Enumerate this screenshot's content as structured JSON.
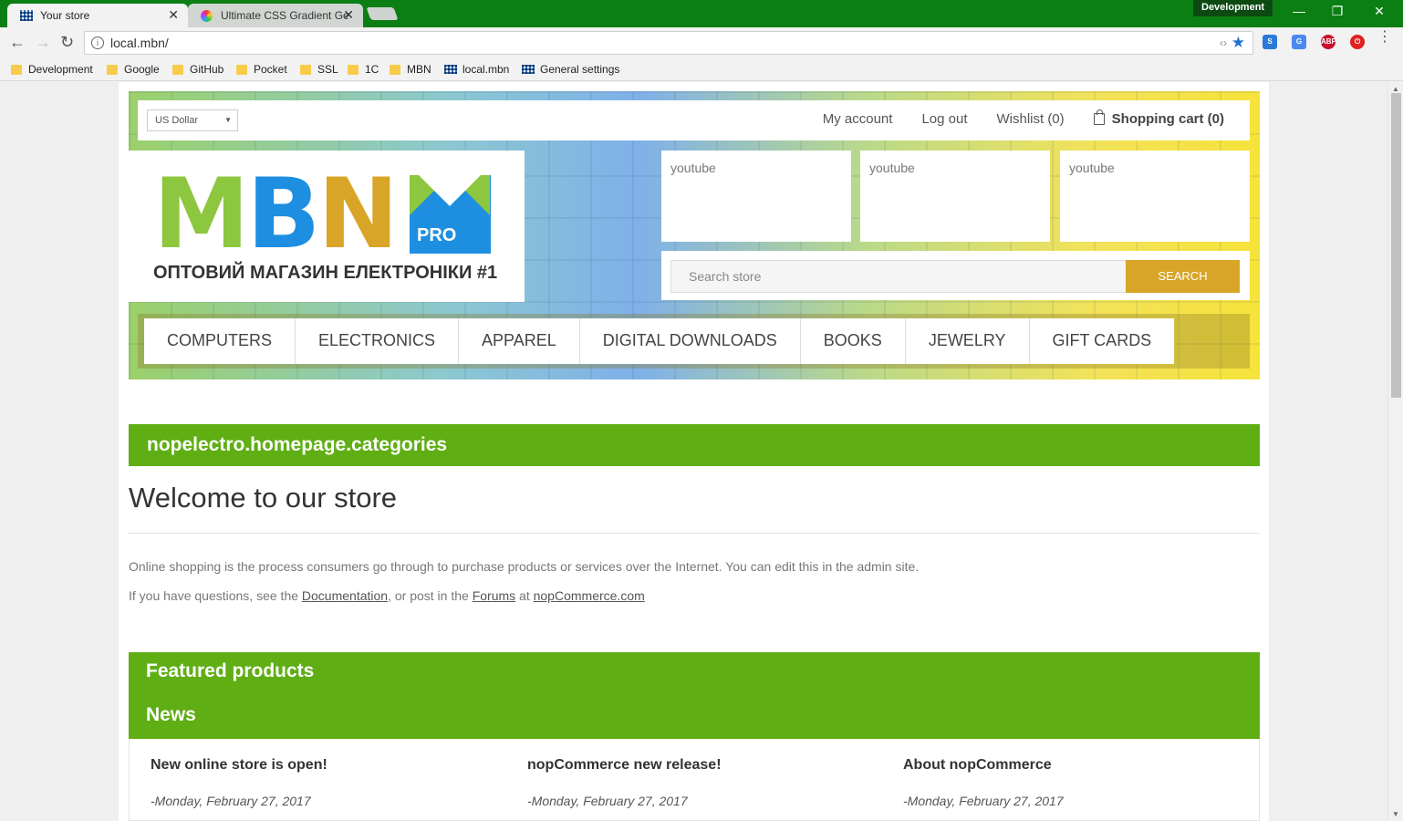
{
  "browser": {
    "tabs": [
      {
        "title": "Your store",
        "active": true
      },
      {
        "title": "Ultimate CSS Gradient Generator",
        "active": false
      }
    ],
    "profile": "Development",
    "url": "local.mbn/",
    "bookmarks": [
      {
        "label": "Development",
        "icon": "folder-icon"
      },
      {
        "label": "Google",
        "icon": "folder-icon"
      },
      {
        "label": "GitHub",
        "icon": "folder-icon"
      },
      {
        "label": "Pocket",
        "icon": "folder-icon"
      },
      {
        "label": "SSL",
        "icon": "folder-icon"
      },
      {
        "label": "1C",
        "icon": "folder-icon"
      },
      {
        "label": "MBN",
        "icon": "folder-icon"
      },
      {
        "label": "local.mbn",
        "icon": "grid-icon"
      },
      {
        "label": "General settings",
        "icon": "grid-icon"
      }
    ],
    "extensions": {
      "abp": "ABP"
    }
  },
  "header": {
    "currency": "US Dollar",
    "links": {
      "my_account": "My account",
      "log_out": "Log out",
      "wishlist": "Wishlist (0)",
      "cart": "Shopping cart (0)"
    },
    "logo": {
      "m": "M",
      "b": "B",
      "n": "N",
      "pro": "PRO",
      "tagline": "ОПТОВИЙ МАГАЗИН ЕЛЕКТРОНІКИ #1"
    },
    "youtube_boxes": [
      "youtube",
      "youtube",
      "youtube"
    ],
    "search": {
      "placeholder": "Search store",
      "button": "SEARCH"
    }
  },
  "menu": [
    "COMPUTERS",
    "ELECTRONICS",
    "APPAREL",
    "DIGITAL DOWNLOADS",
    "BOOKS",
    "JEWELRY",
    "GIFT CARDS"
  ],
  "content": {
    "categories_title": "nopelectro.homepage.categories",
    "welcome_title": "Welcome to our store",
    "intro": "Online shopping is the process consumers go through to purchase products or services over the Internet. You can edit this in the admin site.",
    "questions_prefix": "If you have questions, see the ",
    "documentation_link": "Documentation",
    "questions_mid": ", or post in the ",
    "forums_link": "Forums",
    "questions_at": " at ",
    "nop_link": "nopCommerce.com",
    "featured_title": "Featured products",
    "news_title": "News",
    "news": [
      {
        "title": "New online store is open!",
        "date": "-Monday, February 27, 2017"
      },
      {
        "title": "nopCommerce new release!",
        "date": "-Monday, February 27, 2017"
      },
      {
        "title": "About nopCommerce",
        "date": "-Monday, February 27, 2017"
      }
    ]
  },
  "colors": {
    "chrome_green": "#0b7f14",
    "brand_green": "#5fae14",
    "gold": "#d9a528",
    "blue": "#1e8fe0"
  }
}
